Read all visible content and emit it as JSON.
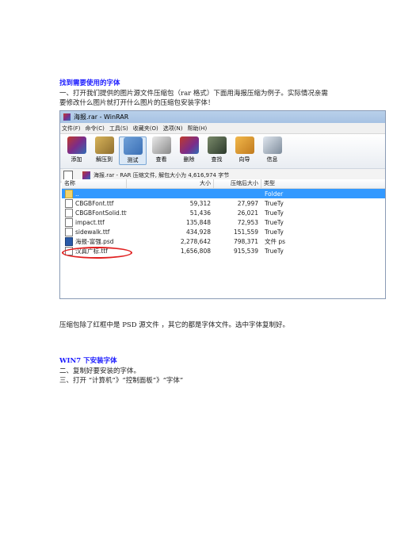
{
  "heading1": "找到需要使用的字体",
  "para1_line1": "一、打开我们提供的图片源文件压缩包（rar 格式）下面用海报压缩为例子。实际情况亲需",
  "para1_line2": "要修改什么图片就打开什么图片的压缩包安装字体！",
  "screenshot": {
    "title": "海报.rar - WinRAR",
    "menu": [
      "文件(F)",
      "命令(C)",
      "工具(S)",
      "收藏夹(O)",
      "选项(N)",
      "帮助(H)"
    ],
    "toolbar": [
      {
        "label": "添加",
        "icon": "add-archive-icon",
        "color": "#b03a2e"
      },
      {
        "label": "解压到",
        "icon": "extract-to-icon",
        "color": "#8e6e2f"
      },
      {
        "label": "测试",
        "icon": "test-icon",
        "color": "#3a6fb5"
      },
      {
        "label": "查看",
        "icon": "view-icon",
        "color": "#5a5a5a"
      },
      {
        "label": "删除",
        "icon": "delete-icon",
        "color": "#7b2c8a"
      },
      {
        "label": "查找",
        "icon": "find-icon",
        "color": "#3c5a3c"
      },
      {
        "label": "向导",
        "icon": "wizard-icon",
        "color": "#c07a1e"
      },
      {
        "label": "信息",
        "icon": "info-icon",
        "color": "#2f6db5"
      }
    ],
    "path": "海报.rar - RAR 压缩文件, 解包大小为 4,616,974 字节",
    "columns": {
      "name": "名称",
      "size": "大小",
      "packed": "压缩后大小",
      "type": "类型"
    },
    "files": [
      {
        "name": "..",
        "size": "",
        "packed": "",
        "type": "Folder",
        "kind": "folder"
      },
      {
        "name": "CBGBFont.ttf",
        "size": "59,312",
        "packed": "27,997",
        "type": "TrueTy",
        "kind": "font"
      },
      {
        "name": "CBGBFontSolid.ttf",
        "size": "51,436",
        "packed": "26,021",
        "type": "TrueTy",
        "kind": "font"
      },
      {
        "name": "impact.ttf",
        "size": "135,848",
        "packed": "72,953",
        "type": "TrueTy",
        "kind": "font"
      },
      {
        "name": "sidewalk.ttf",
        "size": "434,928",
        "packed": "151,559",
        "type": "TrueTy",
        "kind": "font"
      },
      {
        "name": "海报-富强.psd",
        "size": "2,278,642",
        "packed": "798,371",
        "type": "文件 ps",
        "kind": "psd"
      },
      {
        "name": "汉真广标.ttf",
        "size": "1,656,808",
        "packed": "915,539",
        "type": "TrueTy",
        "kind": "font"
      }
    ]
  },
  "caption": "压缩包除了红框中是 PSD 源文件 ，其它的都是字体文件。选中字体复制好。",
  "heading2": "WIN7 下安装字体",
  "step2": "二、复制好要安装的字体。",
  "step3": "三、打开 “计算机”》“控制面板”》“字体”"
}
